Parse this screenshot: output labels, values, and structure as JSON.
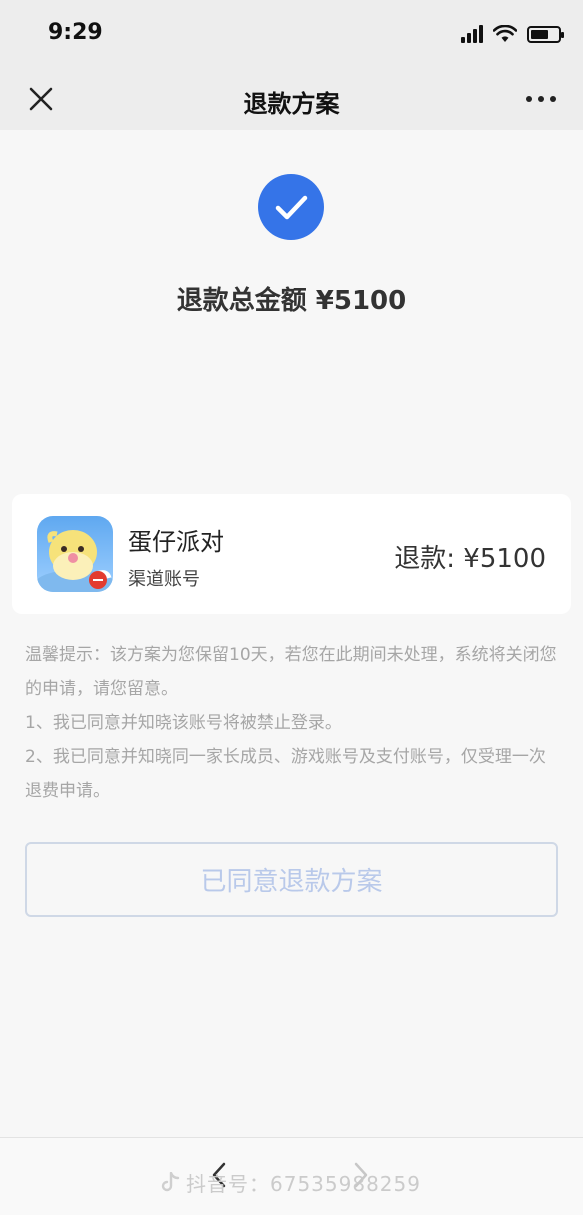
{
  "status_bar": {
    "time": "9:29",
    "battery_level": 0.65
  },
  "nav": {
    "title": "退款方案",
    "close_icon": "close-icon",
    "more_icon": "more-icon"
  },
  "summary": {
    "label": "退款总金额 ¥5100",
    "icon": "checkmark-icon",
    "accent_color": "#3574e8"
  },
  "product": {
    "name": "蛋仔派对",
    "channel": "渠道账号",
    "refund": "退款: ¥5100",
    "icon": "game-app-icon"
  },
  "notice": {
    "lines": [
      "温馨提示：该方案为您保留10天，若您在此期间未处理，系统将关闭您的申请，请您留意。",
      "1、我已同意并知晓该账号将被禁止登录。",
      "2、我已同意并知晓同一家长成员、游戏账号及支付账号，仅受理一次退费申请。"
    ]
  },
  "button": {
    "label": "已同意退款方案"
  },
  "bottom_bar": {
    "watermark": "抖音号：67535988259",
    "back_icon": "back-arrow-icon",
    "forward_icon": "forward-arrow-icon"
  }
}
